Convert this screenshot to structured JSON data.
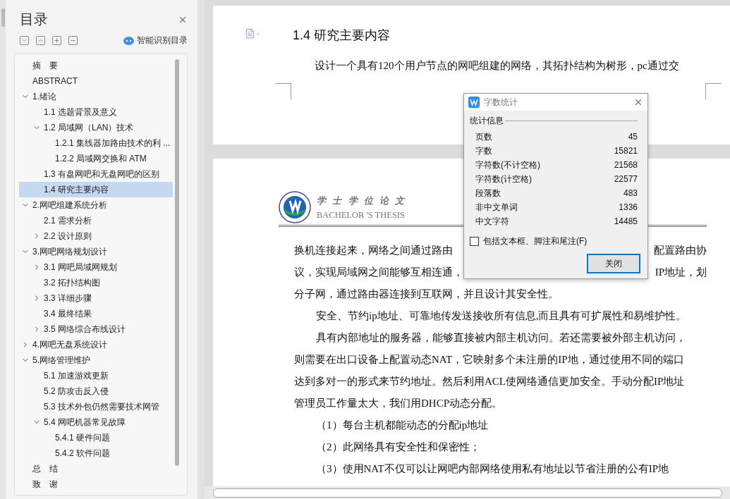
{
  "toc_panel": {
    "title": "目录",
    "smart_toc_label": "智能识别目录",
    "items": [
      {
        "label": "摘　要",
        "selected": false
      },
      {
        "label": "ABSTRACT",
        "selected": false
      },
      {
        "label": "1.绪论",
        "selected": false,
        "expanded": true,
        "children": [
          {
            "label": "1.1 选题背景及意义",
            "selected": false
          },
          {
            "label": "1.2 局域网（LAN）技术",
            "selected": false,
            "expanded": true,
            "children": [
              {
                "label": "1.2.1 集线器加路由技术的利 ...",
                "selected": false
              },
              {
                "label": "1.2.2 局域网交换和 ATM",
                "selected": false
              }
            ]
          },
          {
            "label": "1.3 有盘网吧和无盘网吧的区别",
            "selected": false
          },
          {
            "label": "1.4 研究主要内容",
            "selected": true
          }
        ]
      },
      {
        "label": "2.网吧组建系统分析",
        "selected": false,
        "expanded": true,
        "children": [
          {
            "label": "2.1 需求分析",
            "selected": false
          },
          {
            "label": "2.2 设计原则",
            "selected": false,
            "expanded": false
          }
        ]
      },
      {
        "label": "3.网吧网络规划设计",
        "selected": false,
        "expanded": true,
        "children": [
          {
            "label": "3.1 网吧局域网规划",
            "selected": false,
            "expanded": false
          },
          {
            "label": "3.2 拓扑结构图",
            "selected": false
          },
          {
            "label": "3.3 详细步骤",
            "selected": false,
            "expanded": false
          },
          {
            "label": "3.4 最终结果",
            "selected": false
          },
          {
            "label": "3.5 网络综合布线设计",
            "selected": false,
            "expanded": false
          }
        ]
      },
      {
        "label": "4.网吧无盘系统设计",
        "selected": false,
        "expanded": false
      },
      {
        "label": "5.网络管理维护",
        "selected": false,
        "expanded": true,
        "children": [
          {
            "label": "5.1 加速游戏更新",
            "selected": false
          },
          {
            "label": "5.2 防攻击反入侵",
            "selected": false
          },
          {
            "label": "5.3 技术外包仍然需要技术网管",
            "selected": false
          },
          {
            "label": "5.4 网吧机器常见故障",
            "selected": false,
            "expanded": true,
            "children": [
              {
                "label": "5.4.1 硬件问题",
                "selected": false
              },
              {
                "label": "5.4.2 软件问题",
                "selected": false
              }
            ]
          }
        ]
      },
      {
        "label": "总　结",
        "selected": false
      },
      {
        "label": "致　谢",
        "selected": false
      }
    ]
  },
  "document": {
    "heading": "1.4 研究主要内容",
    "page1_paragraph": "设计一个具有120个用户节点的网吧组建的网络，其拓扑结构为树形，pc通过交",
    "header": {
      "logo_title": "学 士 学 位 论 文",
      "logo_subtitle": "BACHELOR 'S THESIS"
    },
    "lines": [
      {
        "kind": "plain",
        "left": "换机连接起来，网络之间通过路由",
        "right": "配置路由协"
      },
      {
        "kind": "plain",
        "left": "议，实现局域网之间能够互相连通，",
        "right": "IP地址，划"
      },
      {
        "kind": "plain",
        "left": "分子网，通过路由器连接到互联网，并且设计其安全性。"
      },
      {
        "kind": "indented",
        "left": "安全、节约ip地址、可靠地传发送接收所有信息,而且具有可扩展性和易维护性。"
      },
      {
        "kind": "indented",
        "left": "具有内部地址的服务器，能够直接被内部主机访问。若还需要被外部主机访问，"
      },
      {
        "kind": "plain",
        "left": "则需要在出口设备上配置动态NAT，它映射多个未注册的IP地，通过使用不同的端口"
      },
      {
        "kind": "plain",
        "left": "达到多对一的形式来节约地址。然后利用ACL使网络通信更加安全。手动分配IP地址"
      },
      {
        "kind": "plain",
        "left": "管理员工作量太大，我们用DHCP动态分配。"
      },
      {
        "kind": "indented",
        "left": "（1）每台主机都能动态的分配ip地址"
      },
      {
        "kind": "indented",
        "left": "（2）此网络具有安全性和保密性；"
      },
      {
        "kind": "indented",
        "left": "（3）使用NAT不仅可以让网吧内部网络使用私有地址以节省注册的公有IP地"
      }
    ]
  },
  "word_count_dialog": {
    "title": "字数统计",
    "section": "统计信息",
    "stats": [
      {
        "label": "页数",
        "value": "45"
      },
      {
        "label": "字数",
        "value": "15821"
      },
      {
        "label": "字符数(不计空格)",
        "value": "21568"
      },
      {
        "label": "字符数(计空格)",
        "value": "22577"
      },
      {
        "label": "段落数",
        "value": "483"
      },
      {
        "label": "非中文单词",
        "value": "1336"
      },
      {
        "label": "中文字符",
        "value": "14485"
      }
    ],
    "checkbox": {
      "label": "包括文本框、脚注和尾注(F)",
      "checked": false
    },
    "close_button": "关闭"
  }
}
